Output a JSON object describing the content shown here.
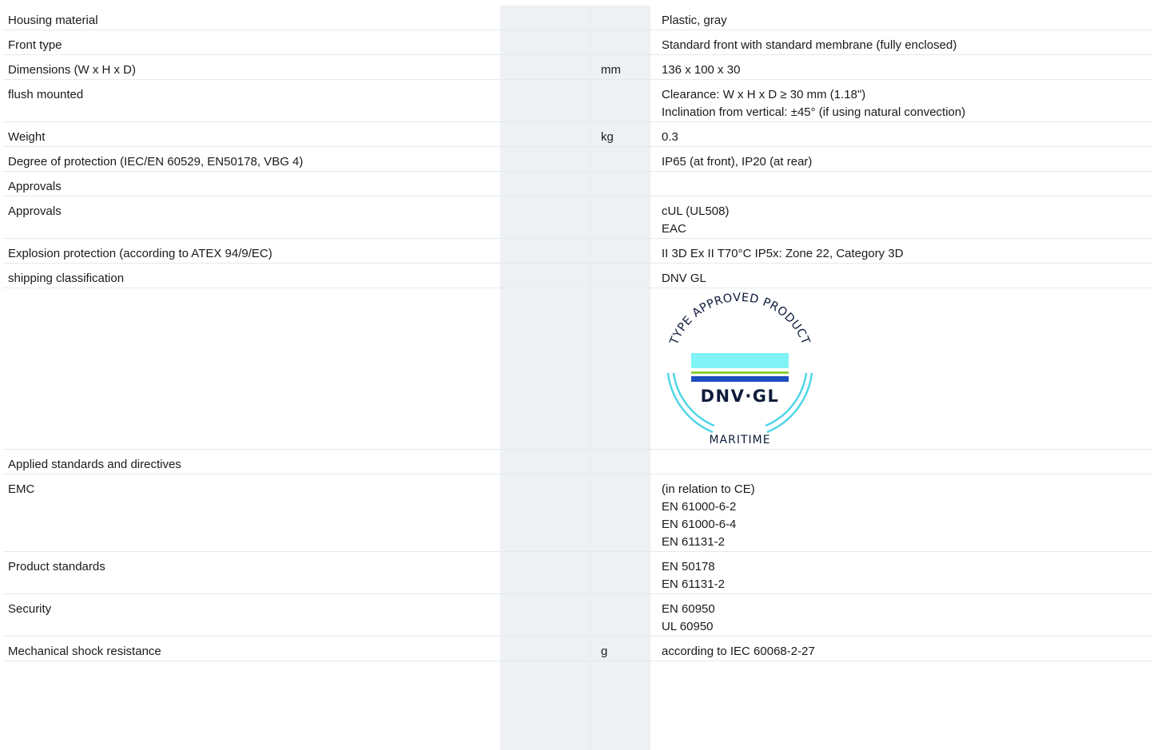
{
  "rows": [
    {
      "label": "Housing material",
      "unit": "",
      "value": [
        "Plastic, gray"
      ]
    },
    {
      "label": "Front type",
      "unit": "",
      "value": [
        "Standard front with standard membrane (fully enclosed)"
      ]
    },
    {
      "label": "Dimensions (W x H x D)",
      "unit": "mm",
      "value": [
        "136 x 100 x 30"
      ]
    },
    {
      "label": "flush mounted",
      "unit": "",
      "value": [
        "Clearance: W x H x D ≥ 30 mm (1.18\")",
        "Inclination from vertical: ±45° (if using natural convection)"
      ]
    },
    {
      "label": "Weight",
      "unit": "kg",
      "value": [
        "0.3"
      ]
    },
    {
      "label": "Degree of protection (IEC/EN 60529, EN50178, VBG 4)",
      "unit": "",
      "value": [
        "IP65 (at front), IP20 (at rear)"
      ]
    },
    {
      "label": "Approvals",
      "unit": "",
      "value": []
    },
    {
      "label": "Approvals",
      "unit": "",
      "value": [
        "cUL (UL508)",
        "EAC"
      ]
    },
    {
      "label": "Explosion protection (according to ATEX 94/9/EC)",
      "unit": "",
      "value": [
        "II 3D Ex II T70°C IP5x: Zone 22, Category 3D"
      ]
    },
    {
      "label": "shipping classification",
      "unit": "",
      "value": [
        "DNV GL"
      ]
    },
    {
      "label": "Applied standards and directives",
      "unit": "",
      "value": []
    },
    {
      "label": "EMC",
      "unit": "",
      "value": [
        "(in relation to CE)",
        "EN 61000-6-2",
        "EN 61000-6-4",
        "EN 61131-2"
      ]
    },
    {
      "label": "Product standards",
      "unit": "",
      "value": [
        "EN 50178",
        "EN 61131-2"
      ]
    },
    {
      "label": "Security",
      "unit": "",
      "value": [
        "EN 60950",
        "UL 60950"
      ]
    },
    {
      "label": "Mechanical shock resistance",
      "unit": "g",
      "value": [
        "according to IEC 60068-2-27"
      ]
    }
  ],
  "logo": {
    "arc_text": "TYPE APPROVED PRODUCT",
    "brand": "DNV·GL",
    "bottom_text": "MARITIME",
    "colors": {
      "cyan": "#7ff3f6",
      "green": "#8ed03a",
      "blue": "#1c4fc0",
      "navy": "#0f1c3c",
      "ring": "#4fd6e6"
    }
  }
}
